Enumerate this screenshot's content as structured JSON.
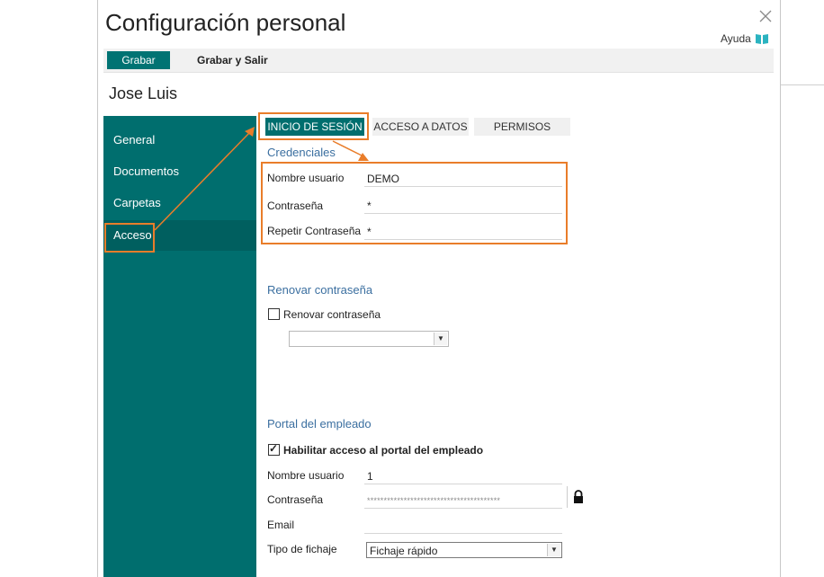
{
  "dialog": {
    "title": "Configuración personal",
    "help_label": "Ayuda"
  },
  "toolbar": {
    "save_label": "Grabar",
    "save_exit_label": "Grabar y Salir"
  },
  "user": {
    "name": "Jose Luis"
  },
  "sidebar": {
    "items": [
      {
        "label": "General"
      },
      {
        "label": "Documentos"
      },
      {
        "label": "Carpetas"
      },
      {
        "label": "Acceso"
      }
    ],
    "active": "Acceso"
  },
  "tabs": [
    {
      "label": "INICIO DE SESIÓN",
      "active": true
    },
    {
      "label": "ACCESO A DATOS",
      "active": false
    },
    {
      "label": "PERMISOS",
      "active": false
    }
  ],
  "credentials": {
    "title": "Credenciales",
    "username_label": "Nombre usuario",
    "username_value": "DEMO",
    "password_label": "Contraseña",
    "password_value": "*",
    "repeat_label": "Repetir Contraseña",
    "repeat_value": "*"
  },
  "renew": {
    "title": "Renovar contraseña",
    "checkbox_label": "Renovar contraseña",
    "checked": false,
    "select_value": ""
  },
  "portal": {
    "title": "Portal del empleado",
    "enable_label": "Habilitar acceso al portal del empleado",
    "enabled": true,
    "username_label": "Nombre usuario",
    "username_value": "1",
    "password_label": "Contraseña",
    "password_value": "****************************************",
    "email_label": "Email",
    "email_value": "",
    "clock_label": "Tipo de fichaje",
    "clock_value": "Fichaje rápido"
  },
  "colors": {
    "accent": "#006e6e",
    "highlight": "#e97d2a",
    "section_title": "#3b6fa0"
  },
  "icons": [
    "close-icon",
    "book-icon",
    "lock-icon",
    "chevron-down-icon"
  ]
}
